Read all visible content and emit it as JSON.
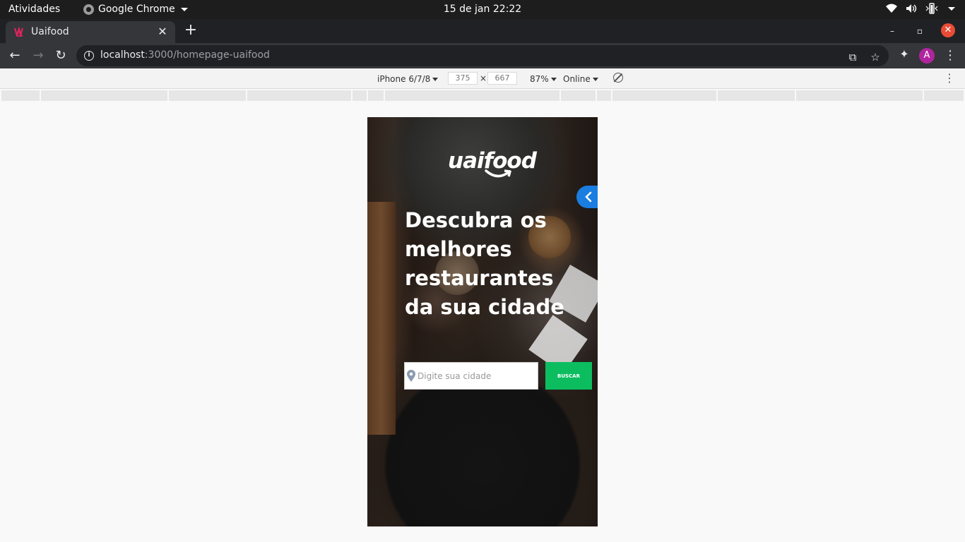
{
  "os": {
    "activities": "Atividades",
    "app_name": "Google Chrome",
    "clock": "15 de jan  22:22"
  },
  "browser": {
    "tab_title": "Uaifood",
    "new_tab": "+",
    "url_host": "localhost",
    "url_rest": ":3000/homepage-uaifood",
    "avatar_letter": "A"
  },
  "devtools": {
    "device": "iPhone 6/7/8",
    "width": "375",
    "times": "×",
    "height": "667",
    "zoom": "87%",
    "network": "Online"
  },
  "page": {
    "logo_text": "uaifood",
    "headline": "Descubra os melhores restaurantes da sua cidade",
    "search_placeholder": "Digite sua cidade",
    "search_button": "BUSCAR",
    "colors": {
      "accent_blue": "#1a7de0",
      "button_green": "#0cbd5f"
    }
  }
}
